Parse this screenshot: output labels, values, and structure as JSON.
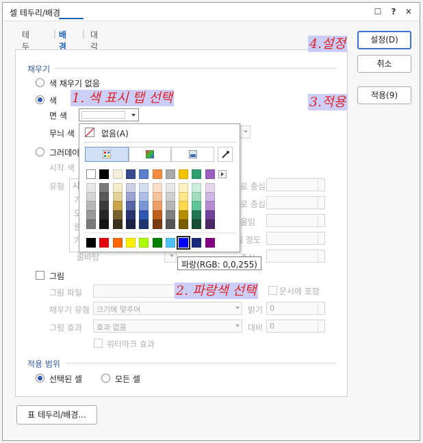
{
  "window": {
    "title": "셀 테두리/배경"
  },
  "titlebar_icons": [
    "chat-icon",
    "help-icon",
    "close-icon"
  ],
  "titlebar_glyphs": {
    "chat": "☐",
    "help": "?",
    "close": "✕"
  },
  "tabs": [
    {
      "label": "테두리",
      "active": false
    },
    {
      "label": "배경",
      "active": true
    },
    {
      "label": "대각선",
      "active": false
    }
  ],
  "buttons": {
    "ok": "설정(D)",
    "cancel": "취소",
    "apply": "적용(9)",
    "border_bg": "표 테두리/배경..."
  },
  "fill": {
    "section": "채우기",
    "no_fill": "색 채우기 없음",
    "color": "색",
    "face_color": "면 색",
    "pattern_color": "무늬 색",
    "gradient": "그러데이",
    "start_color": "시작 색",
    "type": "유형",
    "type_value": "사",
    "row_letters": [
      "가",
      "오",
      "원",
      "가"
    ],
    "plain_value": "줄바탕",
    "center1": "로 중심",
    "center2": "로 중심",
    "tilt": "울임",
    "spread": "심 정도",
    "center3": "중심"
  },
  "picture": {
    "label": "그림",
    "file": "그림 파일",
    "include_in_doc": "문서에 포함",
    "fill_type": "채우기 유형",
    "fill_type_value": "크기에 맞추어",
    "brightness": "밝기",
    "brightness_value": "0",
    "effect": "그림 효과",
    "effect_value": "효과 없음",
    "contrast": "대비",
    "contrast_value": "0",
    "watermark": "워터마크 효과"
  },
  "scope": {
    "section": "적용 범위",
    "selected": "선택된 셀",
    "all": "모든 셀"
  },
  "color_popup": {
    "none": "없음(A)",
    "top_row": [
      "#ffffff",
      "#000000",
      "#f4eedc",
      "#3a4a8c",
      "#5a7fcf",
      "#f28b3c",
      "#aaaaaa",
      "#f5c400",
      "#2e9e6e",
      "#9a5fbf"
    ],
    "shade_cols": [
      [
        "#e8e8e8",
        "#d4d4d4",
        "#b8b8b8",
        "#9a9a9a",
        "#7a7a7a"
      ],
      [
        "#7a7a7a",
        "#5a5a5a",
        "#3c3c3c",
        "#262626",
        "#141414"
      ],
      [
        "#f5eccc",
        "#e3d29c",
        "#c9a44a",
        "#7a6230",
        "#3d3220"
      ],
      [
        "#ccd0e6",
        "#9aa2cf",
        "#5a66a8",
        "#2a336e",
        "#1c2148"
      ],
      [
        "#d4def3",
        "#aec0e8",
        "#7a97d8",
        "#2f57b0",
        "#1e3770"
      ],
      [
        "#fce0cc",
        "#f8c4a0",
        "#f29e68",
        "#c05e1e",
        "#7a3a10"
      ],
      [
        "#e8e8e8",
        "#d0d0d0",
        "#b6b6b6",
        "#808080",
        "#555555"
      ],
      [
        "#fff2c0",
        "#ffe68a",
        "#ffd94d",
        "#b58c00",
        "#7a5e00"
      ],
      [
        "#cdeedd",
        "#a0dec0",
        "#5ec498",
        "#207552",
        "#154d36"
      ],
      [
        "#e6d6f0",
        "#d0b6e4",
        "#b58ad0",
        "#70409a",
        "#4a2a66"
      ]
    ],
    "standard": [
      "#000000",
      "#e60012",
      "#ff6600",
      "#ffee00",
      "#aaff00",
      "#008000",
      "#4fc3f7",
      "#0000ff",
      "#1a2a7a",
      "#800080"
    ],
    "selected_index": 7,
    "tooltip": "파랑(RGB: 0,0,255)"
  },
  "annotations": {
    "step1": "1. 색 표시 탭 선택",
    "step2": "2. 파랑색 선택",
    "step3": "3.적용",
    "step4": "4.설정"
  }
}
